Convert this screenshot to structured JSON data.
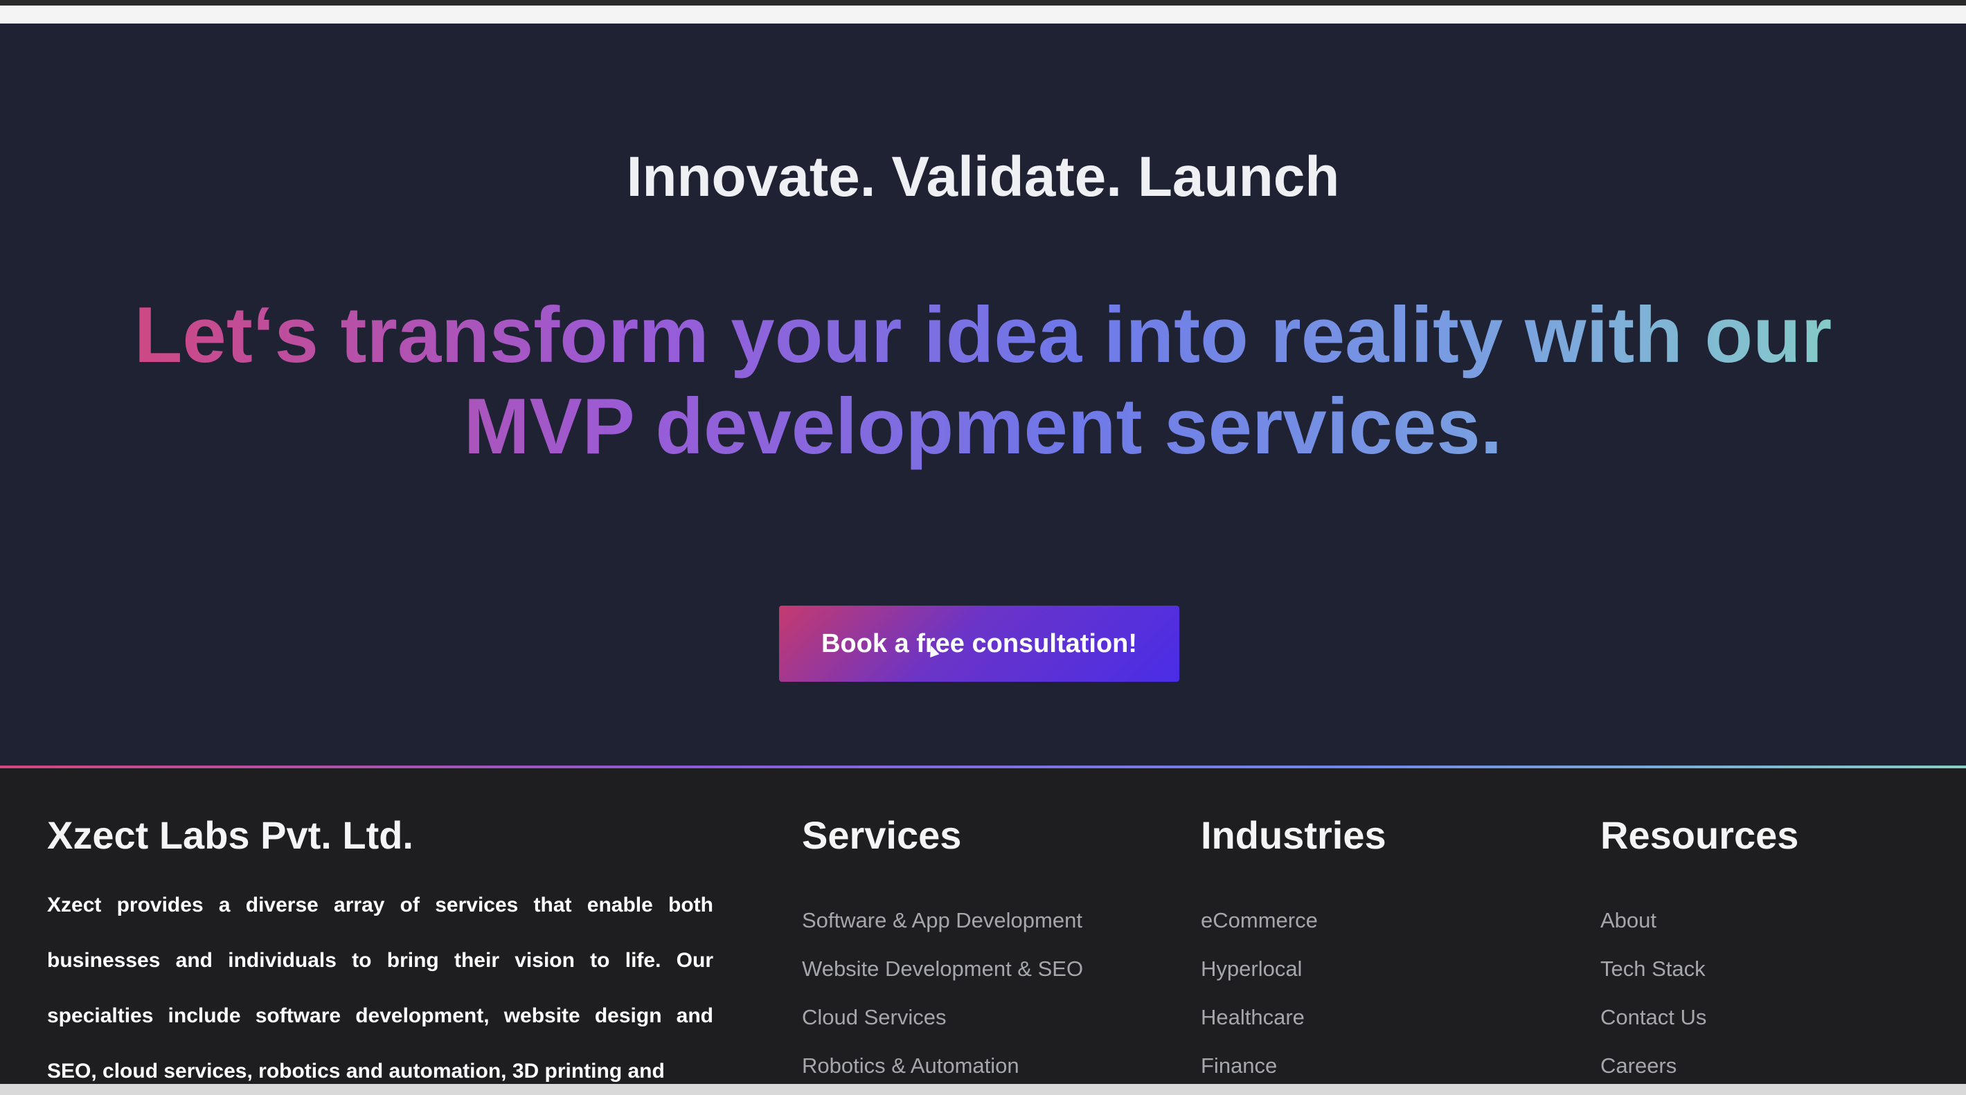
{
  "hero": {
    "tagline": "Innovate. Validate. Launch",
    "headline": "Let‘s transform your idea into reality with our MVP development services.",
    "cta_label": "Book a free consultation!"
  },
  "footer": {
    "company": {
      "name": "Xzect Labs Pvt. Ltd.",
      "description": "Xzect provides a diverse array of services that enable both businesses and individuals to bring their vision to life. Our specialties include software development, website design and SEO, cloud services, robotics and automation, 3D printing and"
    },
    "services": {
      "title": "Services",
      "items": [
        "Software & App Development",
        "Website Development & SEO",
        "Cloud Services",
        "Robotics & Automation"
      ]
    },
    "industries": {
      "title": "Industries",
      "items": [
        "eCommerce",
        "Hyperlocal",
        "Healthcare",
        "Finance"
      ]
    },
    "resources": {
      "title": "Resources",
      "items": [
        "About",
        "Tech Stack",
        "Contact Us",
        "Careers"
      ]
    }
  },
  "colors": {
    "hero_bg": "#1f2233",
    "footer_bg": "#1e1e20",
    "gradient_start": "#d2477e",
    "gradient_mid": "#6f78e8",
    "gradient_end": "#87cfc6",
    "cta_start": "#c53a6e",
    "cta_end": "#4a2de6"
  }
}
